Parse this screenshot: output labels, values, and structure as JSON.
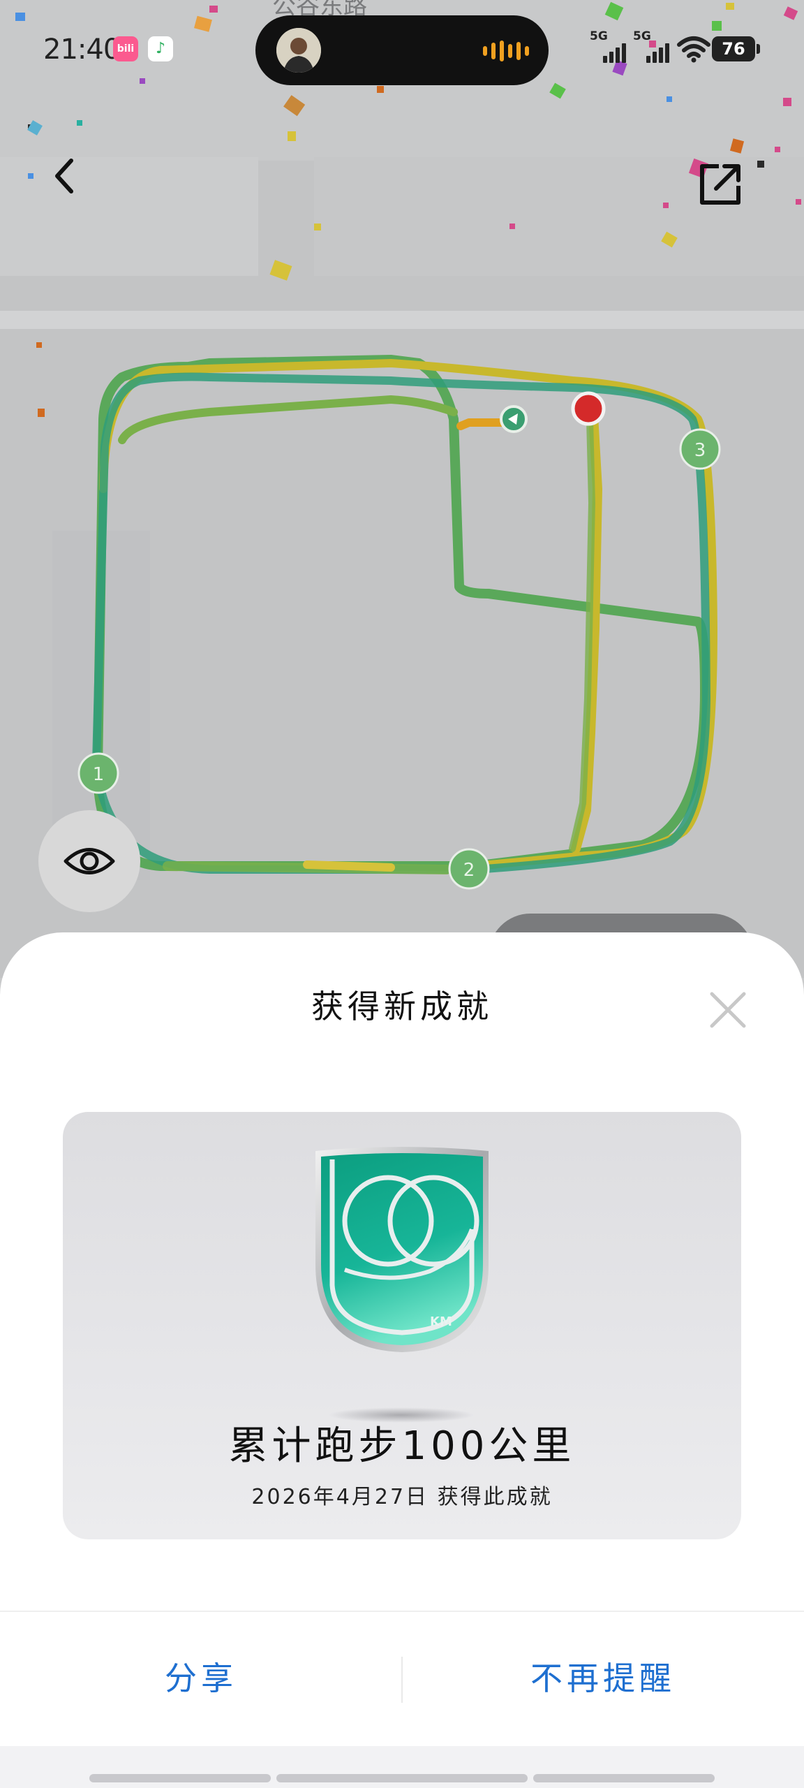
{
  "status_bar": {
    "time": "21:40",
    "app_badges": [
      {
        "name": "bilibili-badge",
        "text": "bili",
        "color": "#fb5a8f"
      },
      {
        "name": "qq-music-badge",
        "text": "♪",
        "color": "#f5d94a"
      }
    ],
    "signal_labels": [
      "5G",
      "5G"
    ],
    "battery": "76"
  },
  "map": {
    "street_label": "公谷东路",
    "markers": [
      "1",
      "2",
      "3"
    ]
  },
  "sheet": {
    "title": "获得新成就",
    "badge_unit": "KM",
    "achievement_name": "累计跑步100公里",
    "achievement_date": "2026年4月27日  获得此成就",
    "share_label": "分享",
    "no_remind_label": "不再提醒"
  },
  "colors": {
    "accent_blue": "#1e6fd0",
    "route_green": "#3aa86a",
    "route_yellow": "#c8b82c",
    "marker_green": "#6bb46d",
    "end_marker_red": "#d42a2a",
    "badge_teal": "#14a98c"
  }
}
